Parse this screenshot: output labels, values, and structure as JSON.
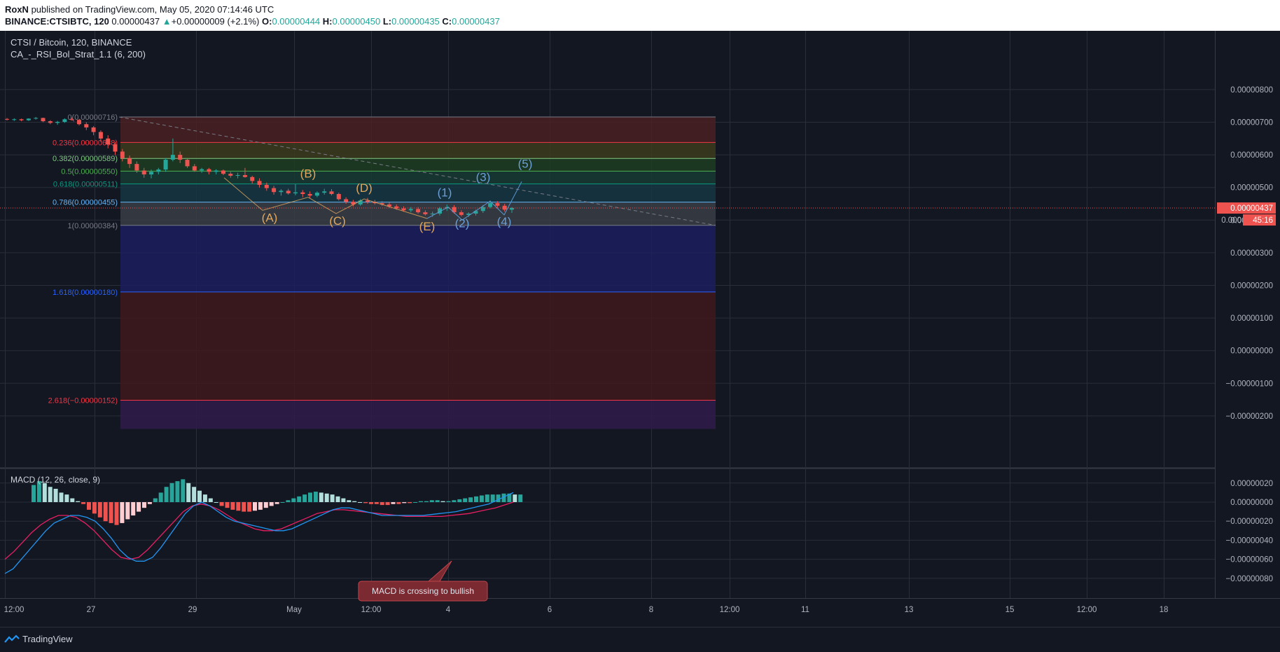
{
  "header": {
    "author": "RoxN",
    "published": "published on TradingView.com, May 05, 2020 07:14:46 UTC",
    "symbol": "BINANCE:CTSIBTC, 120",
    "last": "0.00000437",
    "change_arrow": "▲",
    "change": "+0.00000009 (+2.1%)",
    "o_label": "O:",
    "o_val": "0.00000444",
    "h_label": "H:",
    "h_val": "0.00000450",
    "l_label": "L:",
    "l_val": "0.00000435",
    "c_label": "C:",
    "c_val": "0.00000437"
  },
  "legend": {
    "title": "CTSI / Bitcoin, 120, BINANCE",
    "strategy": "CA_-_RSI_Bol_Strat_1.1 (6, 200)",
    "macd": "MACD (12, 26, close, 9)"
  },
  "price_axis": {
    "labels": [
      "0.00000800",
      "0.00000700",
      "0.00000600",
      "0.00000500",
      "0.00000400",
      "0.00000300",
      "0.00000200",
      "0.00000100",
      "0.00000000",
      "−0.00000100",
      "−0.00000200"
    ],
    "current_price": "0.00000437",
    "countdown": "45:16",
    "partial_label": "0.000"
  },
  "macd_axis": {
    "labels": [
      "0.00000020",
      "0.00000000",
      "−0.00000020",
      "−0.00000040",
      "−0.00000060",
      "−0.00000080"
    ]
  },
  "time_axis": {
    "labels": [
      "12:00",
      "27",
      "29",
      "May",
      "12:00",
      "4",
      "6",
      "8",
      "12:00",
      "11",
      "13",
      "15",
      "12:00",
      "18"
    ]
  },
  "fib_levels": [
    {
      "label": "0(0.00000716)",
      "value": 716,
      "color": "#787b86"
    },
    {
      "label": "0.236(0.00000638)",
      "value": 638,
      "color": "#f23645"
    },
    {
      "label": "0.382(0.00000589)",
      "value": 589,
      "color": "#81c784"
    },
    {
      "label": "0.5(0.00000550)",
      "value": 550,
      "color": "#4caf50"
    },
    {
      "label": "0.618(0.00000511)",
      "value": 511,
      "color": "#089981"
    },
    {
      "label": "0.786(0.00000455)",
      "value": 455,
      "color": "#64b5f6"
    },
    {
      "label": "1(0.00000384)",
      "value": 384,
      "color": "#787b86"
    },
    {
      "label": "1.618(0.00000180)",
      "value": 180,
      "color": "#2962ff"
    },
    {
      "label": "2.618(−0.00000152)",
      "value": -152,
      "color": "#f23645"
    }
  ],
  "wave_labels": [
    {
      "text": "(A)",
      "color": "#e0a85f"
    },
    {
      "text": "(B)",
      "color": "#e0a85f"
    },
    {
      "text": "(C)",
      "color": "#e0a85f"
    },
    {
      "text": "(D)",
      "color": "#e0a85f"
    },
    {
      "text": "(E)",
      "color": "#e0a85f"
    },
    {
      "text": "(1)",
      "color": "#6a9fd8"
    },
    {
      "text": "(2)",
      "color": "#6a9fd8"
    },
    {
      "text": "(3)",
      "color": "#6a9fd8"
    },
    {
      "text": "(4)",
      "color": "#6a9fd8"
    },
    {
      "text": "(5)",
      "color": "#6a9fd8"
    }
  ],
  "annotation": "MACD is crossing to bullish",
  "footer": {
    "brand": "TradingView"
  },
  "colors": {
    "up": "#26a69a",
    "down": "#ef5350",
    "macd": "#2196f3",
    "signal": "#e91e63",
    "bg": "#131722",
    "grid": "#2a2e39"
  },
  "chart_data": [
    {
      "type": "candlestick",
      "title": "CTSI / Bitcoin, 120, BINANCE",
      "ylim": [
        -2.4e-06,
        8.4e-06
      ],
      "note": "price values in satoshi units (x1e-8 BTC), estimated",
      "candles": [
        [
          710,
          713,
          705,
          708
        ],
        [
          708,
          712,
          704,
          709
        ],
        [
          709,
          711,
          703,
          706
        ],
        [
          706,
          712,
          704,
          711
        ],
        [
          711,
          716,
          708,
          713
        ],
        [
          713,
          714,
          700,
          703
        ],
        [
          703,
          706,
          694,
          698
        ],
        [
          698,
          704,
          692,
          701
        ],
        [
          701,
          712,
          698,
          709
        ],
        [
          709,
          714,
          705,
          707
        ],
        [
          707,
          709,
          690,
          694
        ],
        [
          694,
          700,
          676,
          684
        ],
        [
          684,
          688,
          660,
          670
        ],
        [
          670,
          675,
          640,
          650
        ],
        [
          650,
          660,
          620,
          632
        ],
        [
          632,
          640,
          600,
          610
        ],
        [
          610,
          618,
          580,
          590
        ],
        [
          590,
          598,
          560,
          572
        ],
        [
          572,
          580,
          545,
          552
        ],
        [
          552,
          560,
          530,
          540
        ],
        [
          540,
          555,
          528,
          548
        ],
        [
          548,
          560,
          540,
          555
        ],
        [
          555,
          590,
          548,
          585
        ],
        [
          585,
          650,
          580,
          600
        ],
        [
          600,
          610,
          575,
          585
        ],
        [
          585,
          590,
          560,
          565
        ],
        [
          565,
          572,
          548,
          552
        ],
        [
          552,
          560,
          545,
          556
        ],
        [
          556,
          560,
          540,
          548
        ],
        [
          548,
          556,
          540,
          552
        ],
        [
          552,
          555,
          538,
          542
        ],
        [
          542,
          548,
          530,
          536
        ],
        [
          536,
          545,
          528,
          538
        ],
        [
          538,
          560,
          530,
          532
        ],
        [
          532,
          536,
          512,
          520
        ],
        [
          520,
          528,
          500,
          508
        ],
        [
          508,
          515,
          490,
          498
        ],
        [
          498,
          505,
          478,
          486
        ],
        [
          486,
          495,
          475,
          490
        ],
        [
          490,
          496,
          478,
          482
        ],
        [
          482,
          510,
          476,
          485
        ],
        [
          485,
          492,
          470,
          480
        ],
        [
          480,
          488,
          468,
          475
        ],
        [
          475,
          488,
          470,
          484
        ],
        [
          484,
          496,
          478,
          488
        ],
        [
          488,
          495,
          476,
          480
        ],
        [
          480,
          484,
          460,
          464
        ],
        [
          464,
          470,
          450,
          456
        ],
        [
          456,
          462,
          442,
          448
        ],
        [
          448,
          464,
          444,
          460
        ],
        [
          460,
          468,
          450,
          456
        ],
        [
          456,
          462,
          448,
          452
        ],
        [
          452,
          458,
          444,
          448
        ],
        [
          448,
          454,
          438,
          442
        ],
        [
          442,
          448,
          432,
          436
        ],
        [
          436,
          442,
          426,
          430
        ],
        [
          430,
          440,
          424,
          434
        ],
        [
          434,
          440,
          420,
          424
        ],
        [
          424,
          430,
          414,
          418
        ],
        [
          418,
          426,
          410,
          420
        ],
        [
          420,
          440,
          414,
          436
        ],
        [
          436,
          448,
          428,
          440
        ],
        [
          440,
          446,
          420,
          424
        ],
        [
          424,
          430,
          412,
          416
        ],
        [
          416,
          424,
          410,
          420
        ],
        [
          420,
          432,
          414,
          428
        ],
        [
          428,
          446,
          422,
          440
        ],
        [
          440,
          460,
          436,
          452
        ],
        [
          452,
          458,
          438,
          444
        ],
        [
          444,
          450,
          426,
          432
        ],
        [
          432,
          440,
          422,
          437
        ]
      ]
    },
    {
      "type": "bar",
      "title": "MACD (12, 26, close, 9)",
      "ylim": [
        -8.5e-08,
        2.5e-08
      ],
      "histogram": [
        18,
        22,
        20,
        16,
        14,
        10,
        8,
        4,
        1,
        -2,
        -8,
        -12,
        -16,
        -20,
        -22,
        -24,
        -22,
        -18,
        -14,
        -10,
        -6,
        -2,
        4,
        10,
        16,
        20,
        22,
        24,
        20,
        16,
        12,
        8,
        4,
        0,
        -4,
        -6,
        -8,
        -9,
        -10,
        -10,
        -9,
        -8,
        -6,
        -4,
        -2,
        0,
        2,
        4,
        6,
        8,
        10,
        11,
        10,
        9,
        8,
        6,
        4,
        2,
        1,
        0,
        -1,
        -2,
        -2,
        -3,
        -3,
        -2,
        -2,
        -1,
        -1,
        0,
        1,
        1,
        2,
        2,
        1,
        1,
        2,
        3,
        4,
        5,
        6,
        7,
        8,
        8,
        8,
        9,
        9,
        8,
        8
      ],
      "macd_line": [
        -75,
        -70,
        -60,
        -50,
        -40,
        -30,
        -22,
        -18,
        -14,
        -14,
        -16,
        -20,
        -28,
        -38,
        -50,
        -58,
        -62,
        -62,
        -58,
        -48,
        -36,
        -24,
        -12,
        -4,
        0,
        -4,
        -10,
        -16,
        -20,
        -22,
        -24,
        -26,
        -28,
        -30,
        -30,
        -28,
        -24,
        -20,
        -16,
        -12,
        -8,
        -6,
        -6,
        -8,
        -10,
        -12,
        -14,
        -14,
        -14,
        -14,
        -14,
        -14,
        -13,
        -12,
        -11,
        -10,
        -8,
        -6,
        -4,
        -2,
        2,
        6,
        10
      ],
      "signal_line": [
        -60,
        -52,
        -42,
        -32,
        -24,
        -18,
        -14,
        -14,
        -16,
        -22,
        -30,
        -40,
        -50,
        -58,
        -60,
        -58,
        -50,
        -40,
        -30,
        -20,
        -10,
        -4,
        -2,
        -4,
        -8,
        -14,
        -20,
        -24,
        -28,
        -30,
        -30,
        -28,
        -24,
        -20,
        -16,
        -12,
        -10,
        -8,
        -8,
        -9,
        -10,
        -11,
        -12,
        -13,
        -14,
        -15,
        -15,
        -15,
        -15,
        -15,
        -14,
        -13,
        -12,
        -10,
        -8,
        -6,
        -3,
        0
      ]
    }
  ]
}
